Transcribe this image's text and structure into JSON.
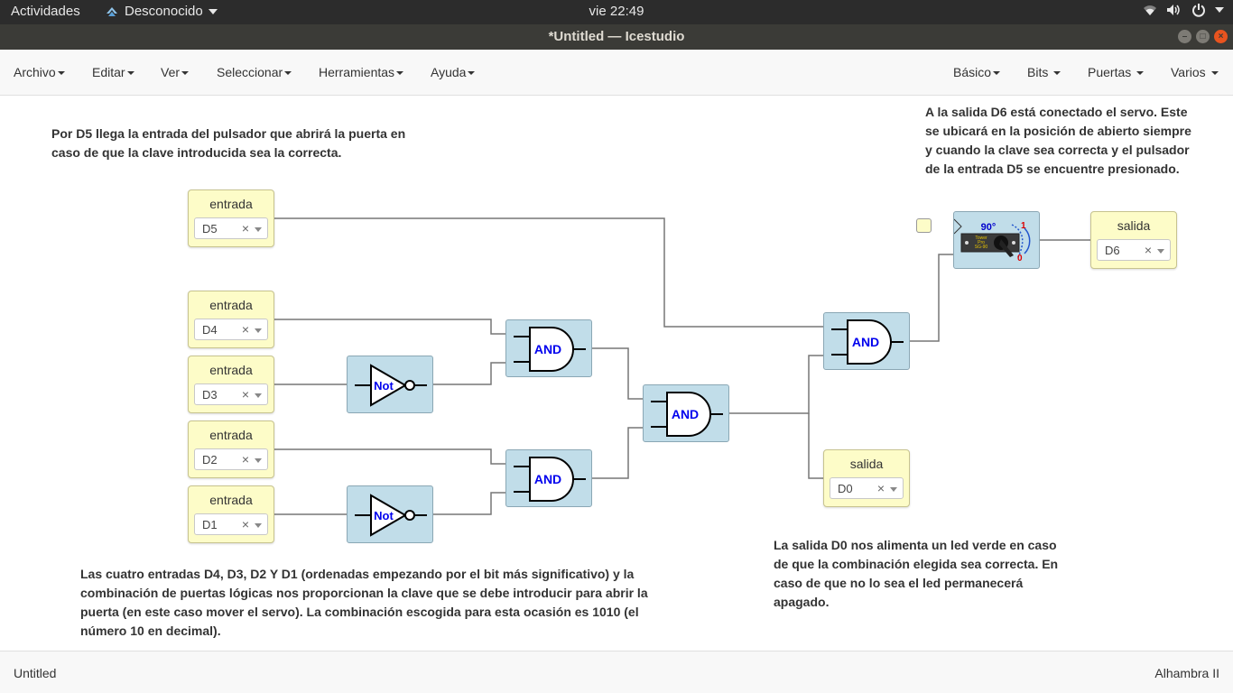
{
  "topbar": {
    "activities": "Actividades",
    "app_name": "Desconocido",
    "clock": "vie 22:49"
  },
  "window": {
    "title": "*Untitled — Icestudio"
  },
  "menu": {
    "left": [
      "Archivo",
      "Editar",
      "Ver",
      "Seleccionar",
      "Herramientas",
      "Ayuda"
    ],
    "right": [
      "Básico",
      "Bits",
      "Puertas",
      "Varios"
    ]
  },
  "notes": {
    "top_left": "Por D5 llega la entrada del pulsador que abrirá la puerta en caso de que la clave introducida sea la correcta.",
    "top_right": "A la salida D6 está conectado el servo. Este se ubicará en la posición de abierto siempre y cuando la clave sea correcta y el pulsador de la entrada D5 se encuentre presionado.",
    "bottom_left": "Las cuatro entradas D4, D3, D2 Y D1 (ordenadas empezando por el bit más significativo) y la combinación de puertas lógicas nos proporcionan la clave que se debe introducir para abrir la puerta (en este caso mover el servo). La combinación escogida para esta ocasión es 1010 (el número 10 en decimal).",
    "bottom_right": "La salida D0 nos alimenta un led verde en caso de que la combinación elegida sea correcta. En caso de que no lo sea el led permanecerá apagado."
  },
  "inputs": [
    {
      "label": "entrada",
      "pin": "D5"
    },
    {
      "label": "entrada",
      "pin": "D4"
    },
    {
      "label": "entrada",
      "pin": "D3"
    },
    {
      "label": "entrada",
      "pin": "D2"
    },
    {
      "label": "entrada",
      "pin": "D1"
    }
  ],
  "outputs": [
    {
      "label": "salida",
      "pin": "D6"
    },
    {
      "label": "salida",
      "pin": "D0"
    }
  ],
  "gates": {
    "and_label": "AND",
    "not_label": "Not"
  },
  "servo": {
    "angle": "90°",
    "high": "1",
    "low": "0",
    "brand_line1": "Tower",
    "brand_line2": "Pro",
    "brand_line3": "SG-90"
  },
  "select_clear": "×",
  "status": {
    "left": "Untitled",
    "right": "Alhambra II"
  },
  "colors": {
    "gate_fill": "#c1dde9",
    "io_fill": "#fdfcc8",
    "gate_text": "#0000ee"
  }
}
